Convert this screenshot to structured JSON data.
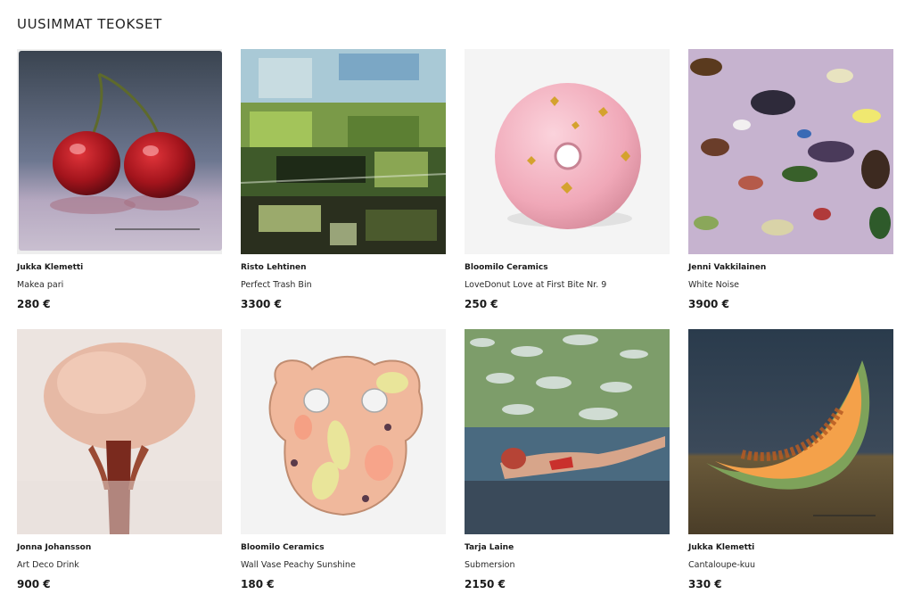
{
  "page": {
    "title": "UUSIMMAT TEOKSET"
  },
  "artworks": [
    {
      "artist": "Jukka Klemetti",
      "title": "Makea pari",
      "price": "280 €",
      "image_icon": "cherries-painting"
    },
    {
      "artist": "Risto Lehtinen",
      "title": "Perfect Trash Bin",
      "price": "3300 €",
      "image_icon": "abstract-landscape-painting"
    },
    {
      "artist": "Bloomilo Ceramics",
      "title": "LoveDonut Love at First Bite Nr. 9",
      "price": "250 €",
      "image_icon": "ceramic-donut"
    },
    {
      "artist": "Jenni Vakkilainen",
      "title": "White Noise",
      "price": "3900 €",
      "image_icon": "abstract-lilac-painting"
    },
    {
      "artist": "Jonna Johansson",
      "title": "Art Deco Drink",
      "price": "900 €",
      "image_icon": "abstract-beige-painting"
    },
    {
      "artist": "Bloomilo Ceramics",
      "title": "Wall Vase Peachy Sunshine",
      "price": "180 €",
      "image_icon": "ceramic-wall-vase"
    },
    {
      "artist": "Tarja Laine",
      "title": "Submersion",
      "price": "2150 €",
      "image_icon": "swimmer-painting"
    },
    {
      "artist": "Jukka Klemetti",
      "title": "Cantaloupe-kuu",
      "price": "330 €",
      "image_icon": "cantaloupe-painting"
    }
  ]
}
